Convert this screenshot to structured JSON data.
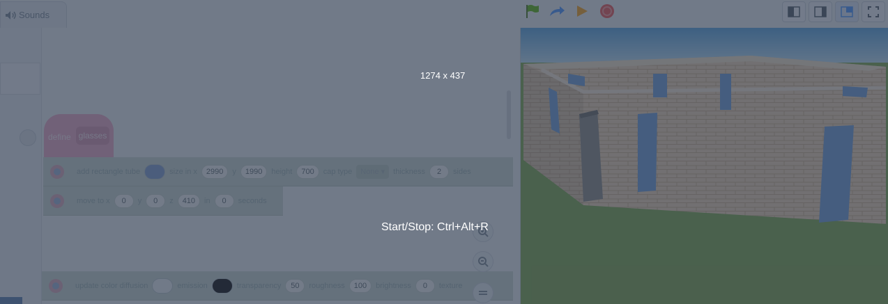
{
  "tabs": {
    "sounds": "Sounds"
  },
  "hat": {
    "define": "define",
    "name": "glasses"
  },
  "blocks": {
    "add_rect": {
      "label": "add rectangle tube",
      "size_label": "size in x",
      "size_x": "2990",
      "y_label": "y",
      "size_y": "1990",
      "height_label": "height",
      "height": "700",
      "cap_label": "cap type",
      "cap_value": "None ▾",
      "thickness_label": "thickness",
      "thickness": "2",
      "sides_label": "sides"
    },
    "move": {
      "label": "move to x",
      "x": "0",
      "y_label": "y",
      "y": "0",
      "z_label": "z",
      "z": "410",
      "in_label": "in",
      "secs": "0",
      "seconds_label": "seconds"
    },
    "color": {
      "label": "update color diffusion",
      "emission_label": "emission",
      "transparency_label": "transparency",
      "transparency": "50",
      "roughness_label": "roughness",
      "roughness": "100",
      "brightness_label": "brightness",
      "brightness": "0",
      "texture_label": "texture"
    }
  },
  "overlay": {
    "size": "1274 x 437",
    "hint": "Start/Stop: Ctrl+Alt+R"
  },
  "colors": {
    "accent": "#4c97ff",
    "looks_block": "#c8d6cf",
    "define_block": "#e9a8c4",
    "wall": "#e8cfae",
    "window": "#6f9ed8",
    "grass": "#7da84e",
    "sky": "#9fd0ee"
  },
  "icons": [
    "speaker-icon",
    "green-flag-icon",
    "redo-icon",
    "play-icon",
    "stop-icon",
    "layout-small-stage-icon",
    "layout-normal-stage-icon",
    "layout-large-stage-icon",
    "fullscreen-icon",
    "zoom-in-icon",
    "zoom-out-icon",
    "zoom-reset-icon",
    "extension-icon"
  ]
}
